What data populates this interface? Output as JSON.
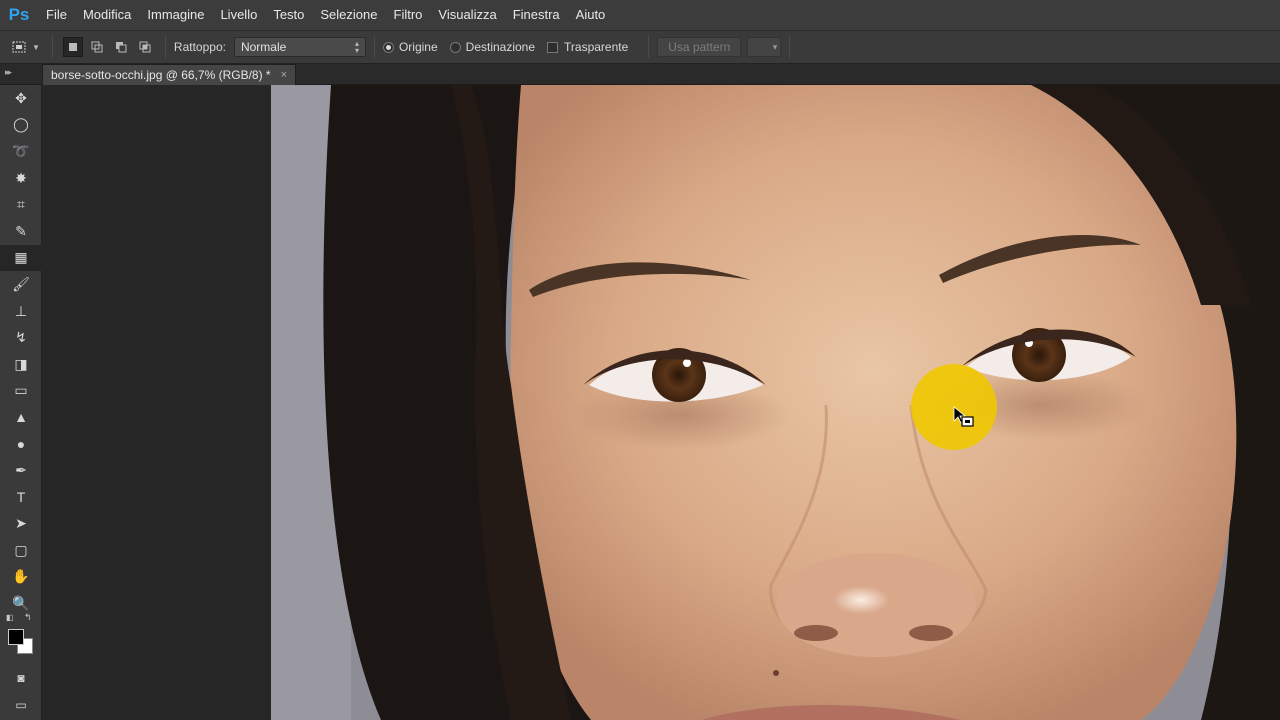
{
  "app": {
    "logo": "Ps"
  },
  "menu": [
    "File",
    "Modifica",
    "Immagine",
    "Livello",
    "Testo",
    "Selezione",
    "Filtro",
    "Visualizza",
    "Finestra",
    "Aiuto"
  ],
  "options": {
    "patch_label": "Rattoppo:",
    "patch_mode": "Normale",
    "source_label": "Origine",
    "destination_label": "Destinazione",
    "transparent_label": "Trasparente",
    "use_pattern_label": "Usa pattern",
    "selected_radio": "Origine"
  },
  "document": {
    "tab_title": "borse-sotto-occhi.jpg @ 66,7% (RGB/8) *",
    "close_glyph": "×"
  },
  "tools": [
    {
      "name": "move-tool-icon",
      "glyph": "✥"
    },
    {
      "name": "elliptical-marquee-tool-icon",
      "glyph": "◯"
    },
    {
      "name": "lasso-tool-icon",
      "glyph": "➰"
    },
    {
      "name": "magic-wand-tool-icon",
      "glyph": "✸"
    },
    {
      "name": "crop-tool-icon",
      "glyph": "⌗"
    },
    {
      "name": "eyedropper-tool-icon",
      "glyph": "✎"
    },
    {
      "name": "patch-tool-icon",
      "glyph": "▦",
      "selected": true
    },
    {
      "name": "brush-tool-icon",
      "glyph": "🖌"
    },
    {
      "name": "clone-stamp-tool-icon",
      "glyph": "⊥"
    },
    {
      "name": "history-brush-tool-icon",
      "glyph": "↯"
    },
    {
      "name": "eraser-tool-icon",
      "glyph": "◨"
    },
    {
      "name": "gradient-tool-icon",
      "glyph": "▭"
    },
    {
      "name": "blur-tool-icon",
      "glyph": "▲"
    },
    {
      "name": "dodge-tool-icon",
      "glyph": "●"
    },
    {
      "name": "pen-tool-icon",
      "glyph": "✒"
    },
    {
      "name": "type-tool-icon",
      "glyph": "T"
    },
    {
      "name": "path-selection-tool-icon",
      "glyph": "➤"
    },
    {
      "name": "shape-tool-icon",
      "glyph": "▢"
    },
    {
      "name": "hand-tool-icon",
      "glyph": "✋"
    },
    {
      "name": "zoom-tool-icon",
      "glyph": "🔍"
    }
  ],
  "colors": {
    "foreground": "#000000",
    "background": "#ffffff",
    "cursor_highlight": "#f0c800"
  }
}
